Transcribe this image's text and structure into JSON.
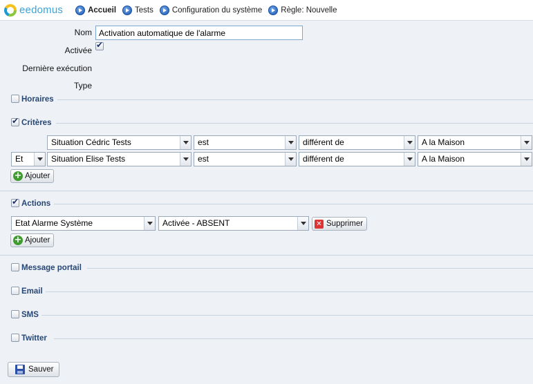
{
  "header": {
    "logo_text": "eedomus",
    "breadcrumb": [
      {
        "label": "Accueil"
      },
      {
        "label": "Tests"
      },
      {
        "label": "Configuration du système"
      },
      {
        "label": "Règle: Nouvelle"
      }
    ]
  },
  "form": {
    "name_label": "Nom",
    "name_value": "Activation automatique de l'alarme",
    "active_label": "Activée",
    "active_checked": true,
    "last_run_label": "Dernière exécution",
    "type_label": "Type"
  },
  "sections": {
    "horaires": {
      "title": "Horaires",
      "checked": false
    },
    "criteres": {
      "title": "Critères",
      "checked": true,
      "rows": [
        {
          "connector": "",
          "device": "Situation Cédric Tests",
          "operator": "est",
          "comparison": "différent de",
          "value": "A la Maison"
        },
        {
          "connector": "Et",
          "device": "Situation Elise Tests",
          "operator": "est",
          "comparison": "différent de",
          "value": "A la Maison"
        }
      ],
      "add_label": "Ajouter"
    },
    "actions": {
      "title": "Actions",
      "checked": true,
      "rows": [
        {
          "device": "Etat Alarme Système",
          "value": "Activée - ABSENT",
          "delete_label": "Supprimer"
        }
      ],
      "add_label": "Ajouter"
    },
    "message_portail": {
      "title": "Message portail",
      "checked": false
    },
    "email": {
      "title": "Email",
      "checked": false
    },
    "sms": {
      "title": "SMS",
      "checked": false
    },
    "twitter": {
      "title": "Twitter",
      "checked": false
    }
  },
  "save_label": "Sauver",
  "colors": {
    "accent": "#274673",
    "logo": "#3aa3d8",
    "add_green": "#3f9b2f",
    "delete_red": "#d33333"
  }
}
